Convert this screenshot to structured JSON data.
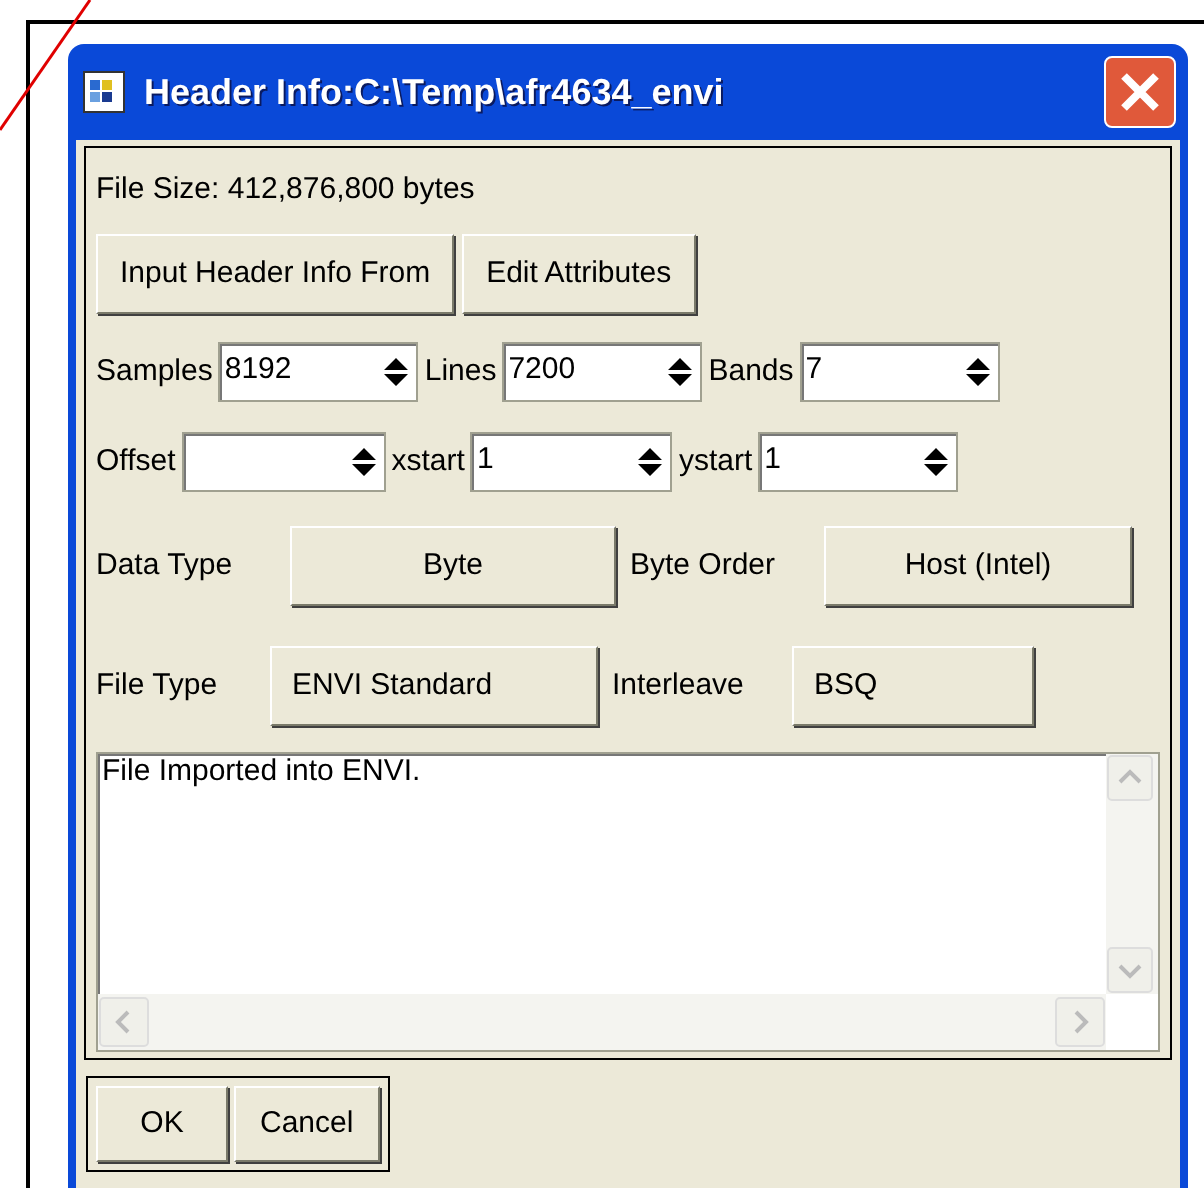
{
  "window": {
    "title": "Header Info:C:\\Temp\\afr4634_envi"
  },
  "file_size": "File Size: 412,876,800 bytes",
  "top_buttons": [
    "Input Header Info From",
    "Edit Attributes"
  ],
  "spin_rows": [
    [
      {
        "label": "Samples",
        "value": "8192"
      },
      {
        "label": "Lines",
        "value": "7200"
      },
      {
        "label": "Bands",
        "value": "7"
      }
    ],
    [
      {
        "label": "Offset"
      },
      {
        "label": "xstart",
        "value": "1"
      },
      {
        "label": "ystart",
        "value": "1"
      }
    ]
  ],
  "choice_rows": [
    [
      {
        "label": "Data Type",
        "value": "Byte"
      },
      {
        "label": "Byte Order",
        "value": "Host (Intel)"
      }
    ],
    [
      {
        "label": "File Type",
        "value": "ENVI Standard"
      },
      {
        "label": "Interleave",
        "value": "BSQ"
      }
    ]
  ],
  "log": {
    "text": "File Imported into ENVI."
  },
  "bottom_buttons": [
    "OK",
    "Cancel"
  ]
}
